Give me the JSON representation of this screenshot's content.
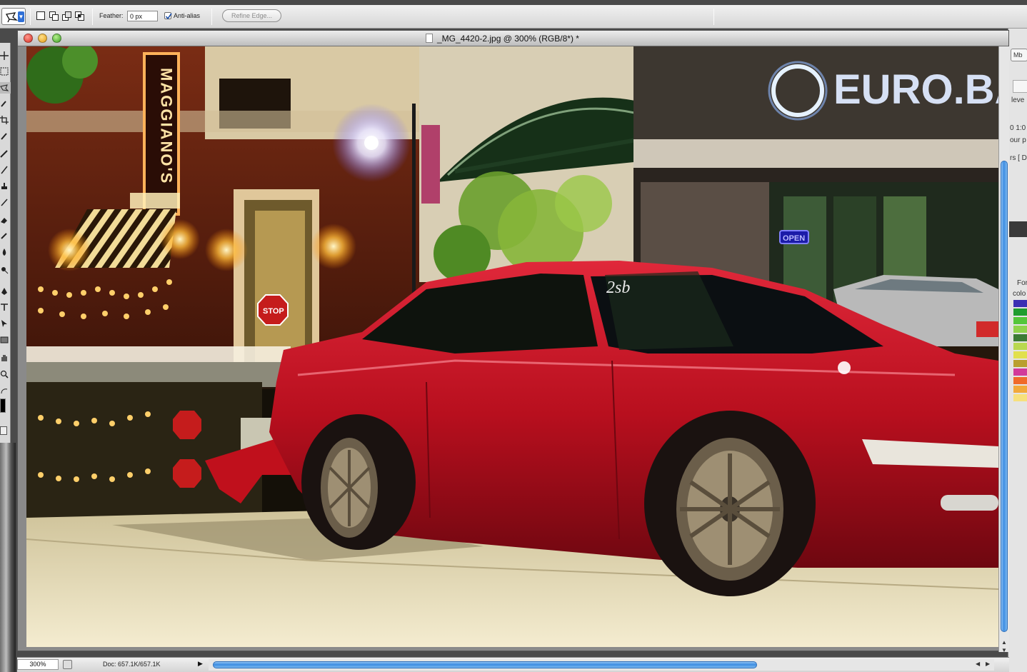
{
  "options_bar": {
    "feather_label": "Feather:",
    "feather_value": "0 px",
    "antialias_label": "Anti-alias",
    "antialias_checked": true,
    "refine_edge_label": "Refine Edge..."
  },
  "document": {
    "title": "_MG_4420-2.jpg @ 300% (RGB/8*) *",
    "image": {
      "sign_vertical": "MAGGIANO'S",
      "sign_euro": "EURO.BA",
      "stop_sign": "STOP",
      "open_sign": "OPEN",
      "windshield_text": "2sb"
    }
  },
  "status_bar": {
    "zoom": "300%",
    "doc_size": "Doc: 657.1K/657.1K"
  },
  "right_panel": {
    "tab_label": "Mb",
    "texts": [
      "leve",
      "0 1:0",
      "our p",
      "rs [ D",
      "For",
      "colo"
    ]
  },
  "colors": {
    "selection_blue": "#3d8de2",
    "car_red": "#c0101c"
  }
}
